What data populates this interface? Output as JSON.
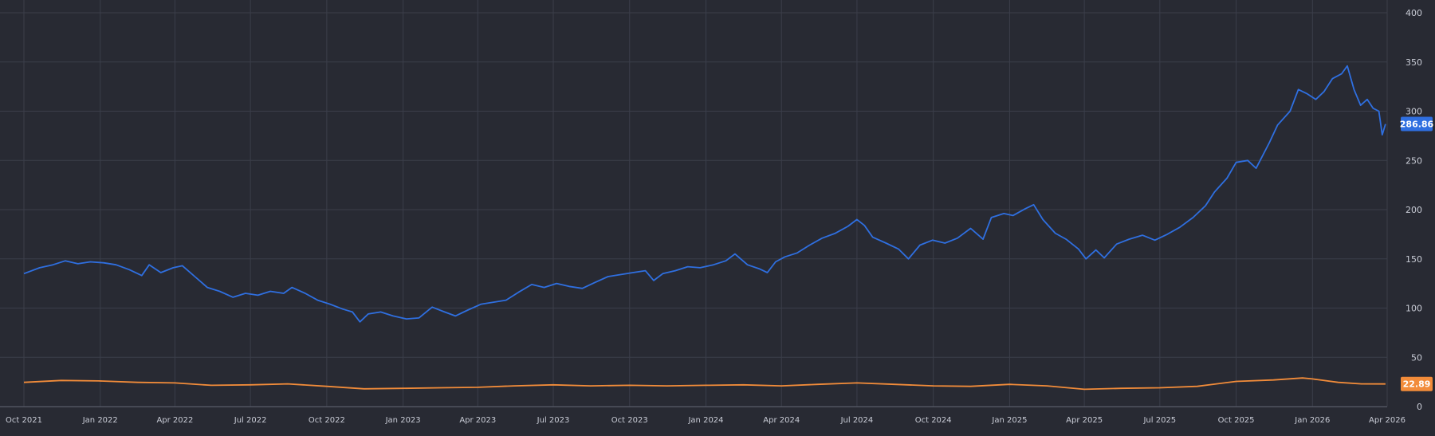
{
  "colors": {
    "background": "#282a33",
    "grid": "#3b3e4a",
    "axis": "#5a5e6b",
    "tick_text": "#c9ccd6",
    "series_blue": "#2f6fe0",
    "series_orange": "#f28c3a",
    "badge_text": "#ffffff"
  },
  "chart_data": {
    "type": "line",
    "x_axis": {
      "type": "date",
      "range": [
        "2021-10-01",
        "2026-04-01"
      ],
      "ticks": [
        {
          "date": "2021-10-01",
          "label": "Oct 2021"
        },
        {
          "date": "2022-01-01",
          "label": "Jan 2022"
        },
        {
          "date": "2022-04-01",
          "label": "Apr 2022"
        },
        {
          "date": "2022-07-01",
          "label": "Jul 2022"
        },
        {
          "date": "2022-10-01",
          "label": "Oct 2022"
        },
        {
          "date": "2023-01-01",
          "label": "Jan 2023"
        },
        {
          "date": "2023-04-01",
          "label": "Apr 2023"
        },
        {
          "date": "2023-07-01",
          "label": "Jul 2023"
        },
        {
          "date": "2023-10-01",
          "label": "Oct 2023"
        },
        {
          "date": "2024-01-01",
          "label": "Jan 2024"
        },
        {
          "date": "2024-04-01",
          "label": "Apr 2024"
        },
        {
          "date": "2024-07-01",
          "label": "Jul 2024"
        },
        {
          "date": "2024-10-01",
          "label": "Oct 2024"
        },
        {
          "date": "2025-01-01",
          "label": "Jan 2025"
        },
        {
          "date": "2025-04-01",
          "label": "Apr 2025"
        },
        {
          "date": "2025-07-01",
          "label": "Jul 2025"
        },
        {
          "date": "2025-10-01",
          "label": "Oct 2025"
        },
        {
          "date": "2026-01-01",
          "label": "Jan 2026"
        },
        {
          "date": "2026-04-01",
          "label": "Apr 2026"
        }
      ]
    },
    "y_axis": {
      "position": "right",
      "range": [
        0,
        400
      ],
      "ticks": [
        0,
        50,
        100,
        150,
        200,
        250,
        300,
        350,
        400
      ]
    },
    "grid": true,
    "series": [
      {
        "key": "blue",
        "color": "#2f6fe0",
        "last_value_label": "286.86",
        "points": [
          [
            "2021-10-01",
            135
          ],
          [
            "2021-10-20",
            141
          ],
          [
            "2021-11-05",
            144
          ],
          [
            "2021-11-20",
            148
          ],
          [
            "2021-12-05",
            145
          ],
          [
            "2021-12-20",
            147
          ],
          [
            "2022-01-05",
            146
          ],
          [
            "2022-01-20",
            144
          ],
          [
            "2022-02-05",
            139
          ],
          [
            "2022-02-20",
            133
          ],
          [
            "2022-03-01",
            144
          ],
          [
            "2022-03-15",
            136
          ],
          [
            "2022-03-30",
            141
          ],
          [
            "2022-04-10",
            143
          ],
          [
            "2022-04-25",
            132
          ],
          [
            "2022-05-10",
            121
          ],
          [
            "2022-05-25",
            117
          ],
          [
            "2022-06-10",
            111
          ],
          [
            "2022-06-25",
            115
          ],
          [
            "2022-07-10",
            113
          ],
          [
            "2022-07-25",
            117
          ],
          [
            "2022-08-10",
            115
          ],
          [
            "2022-08-20",
            121
          ],
          [
            "2022-09-05",
            115
          ],
          [
            "2022-09-20",
            108
          ],
          [
            "2022-10-05",
            104
          ],
          [
            "2022-10-20",
            99
          ],
          [
            "2022-11-01",
            96
          ],
          [
            "2022-11-10",
            86
          ],
          [
            "2022-11-20",
            94
          ],
          [
            "2022-12-05",
            96
          ],
          [
            "2022-12-20",
            92
          ],
          [
            "2023-01-05",
            89
          ],
          [
            "2023-01-20",
            90
          ],
          [
            "2023-02-05",
            101
          ],
          [
            "2023-02-20",
            96
          ],
          [
            "2023-03-05",
            92
          ],
          [
            "2023-03-20",
            98
          ],
          [
            "2023-04-05",
            104
          ],
          [
            "2023-04-20",
            106
          ],
          [
            "2023-05-05",
            108
          ],
          [
            "2023-05-20",
            116
          ],
          [
            "2023-06-05",
            124
          ],
          [
            "2023-06-20",
            121
          ],
          [
            "2023-07-05",
            125
          ],
          [
            "2023-07-20",
            122
          ],
          [
            "2023-08-05",
            120
          ],
          [
            "2023-08-20",
            126
          ],
          [
            "2023-09-05",
            132
          ],
          [
            "2023-09-20",
            134
          ],
          [
            "2023-10-05",
            136
          ],
          [
            "2023-10-20",
            138
          ],
          [
            "2023-10-30",
            128
          ],
          [
            "2023-11-10",
            135
          ],
          [
            "2023-11-25",
            138
          ],
          [
            "2023-12-10",
            142
          ],
          [
            "2023-12-25",
            141
          ],
          [
            "2024-01-10",
            144
          ],
          [
            "2024-01-25",
            148
          ],
          [
            "2024-02-05",
            155
          ],
          [
            "2024-02-20",
            144
          ],
          [
            "2024-03-05",
            140
          ],
          [
            "2024-03-15",
            136
          ],
          [
            "2024-03-25",
            147
          ],
          [
            "2024-04-05",
            152
          ],
          [
            "2024-04-20",
            156
          ],
          [
            "2024-05-05",
            164
          ],
          [
            "2024-05-20",
            171
          ],
          [
            "2024-06-05",
            176
          ],
          [
            "2024-06-20",
            183
          ],
          [
            "2024-07-01",
            190
          ],
          [
            "2024-07-10",
            184
          ],
          [
            "2024-07-20",
            172
          ],
          [
            "2024-08-05",
            166
          ],
          [
            "2024-08-20",
            160
          ],
          [
            "2024-09-01",
            150
          ],
          [
            "2024-09-15",
            164
          ],
          [
            "2024-09-30",
            169
          ],
          [
            "2024-10-15",
            166
          ],
          [
            "2024-10-30",
            171
          ],
          [
            "2024-11-15",
            181
          ],
          [
            "2024-11-30",
            170
          ],
          [
            "2024-12-10",
            192
          ],
          [
            "2024-12-25",
            196
          ],
          [
            "2025-01-05",
            194
          ],
          [
            "2025-01-20",
            201
          ],
          [
            "2025-01-30",
            205
          ],
          [
            "2025-02-10",
            190
          ],
          [
            "2025-02-25",
            176
          ],
          [
            "2025-03-10",
            170
          ],
          [
            "2025-03-25",
            160
          ],
          [
            "2025-04-03",
            150
          ],
          [
            "2025-04-15",
            159
          ],
          [
            "2025-04-25",
            151
          ],
          [
            "2025-05-10",
            165
          ],
          [
            "2025-05-25",
            170
          ],
          [
            "2025-06-10",
            174
          ],
          [
            "2025-06-25",
            169
          ],
          [
            "2025-07-10",
            175
          ],
          [
            "2025-07-25",
            182
          ],
          [
            "2025-08-10",
            192
          ],
          [
            "2025-08-25",
            204
          ],
          [
            "2025-09-05",
            218
          ],
          [
            "2025-09-20",
            232
          ],
          [
            "2025-10-01",
            248
          ],
          [
            "2025-10-15",
            250
          ],
          [
            "2025-10-25",
            242
          ],
          [
            "2025-11-10",
            268
          ],
          [
            "2025-11-20",
            286
          ],
          [
            "2025-12-05",
            300
          ],
          [
            "2025-12-15",
            322
          ],
          [
            "2025-12-25",
            318
          ],
          [
            "2026-01-05",
            312
          ],
          [
            "2026-01-15",
            320
          ],
          [
            "2026-01-25",
            333
          ],
          [
            "2026-02-05",
            338
          ],
          [
            "2026-02-12",
            346
          ],
          [
            "2026-02-20",
            322
          ],
          [
            "2026-02-28",
            306
          ],
          [
            "2026-03-08",
            312
          ],
          [
            "2026-03-15",
            303
          ],
          [
            "2026-03-22",
            300
          ],
          [
            "2026-03-26",
            276
          ],
          [
            "2026-03-30",
            287
          ]
        ]
      },
      {
        "key": "orange",
        "color": "#f28c3a",
        "last_value_label": "22.89",
        "points": [
          [
            "2021-10-01",
            24.5
          ],
          [
            "2021-11-15",
            26.5
          ],
          [
            "2021-12-30",
            26
          ],
          [
            "2022-02-15",
            24.5
          ],
          [
            "2022-04-01",
            24
          ],
          [
            "2022-05-15",
            21.5
          ],
          [
            "2022-07-01",
            22
          ],
          [
            "2022-08-15",
            23
          ],
          [
            "2022-10-01",
            20.5
          ],
          [
            "2022-11-15",
            18
          ],
          [
            "2023-01-01",
            18.5
          ],
          [
            "2023-02-15",
            19
          ],
          [
            "2023-04-01",
            19.5
          ],
          [
            "2023-05-15",
            21
          ],
          [
            "2023-07-01",
            22
          ],
          [
            "2023-08-15",
            21
          ],
          [
            "2023-10-01",
            21.5
          ],
          [
            "2023-11-15",
            21
          ],
          [
            "2024-01-01",
            21.5
          ],
          [
            "2024-02-15",
            22
          ],
          [
            "2024-04-01",
            21
          ],
          [
            "2024-05-15",
            22.5
          ],
          [
            "2024-07-01",
            24
          ],
          [
            "2024-08-15",
            22.5
          ],
          [
            "2024-10-01",
            21
          ],
          [
            "2024-11-15",
            20.5
          ],
          [
            "2025-01-01",
            22.5
          ],
          [
            "2025-02-15",
            21
          ],
          [
            "2025-04-01",
            17.5
          ],
          [
            "2025-05-15",
            18.5
          ],
          [
            "2025-07-01",
            19
          ],
          [
            "2025-08-15",
            20.5
          ],
          [
            "2025-10-01",
            25.5
          ],
          [
            "2025-11-15",
            27
          ],
          [
            "2025-12-20",
            29
          ],
          [
            "2026-01-01",
            28
          ],
          [
            "2026-02-01",
            24.5
          ],
          [
            "2026-03-01",
            23
          ],
          [
            "2026-03-30",
            22.89
          ]
        ]
      }
    ]
  }
}
